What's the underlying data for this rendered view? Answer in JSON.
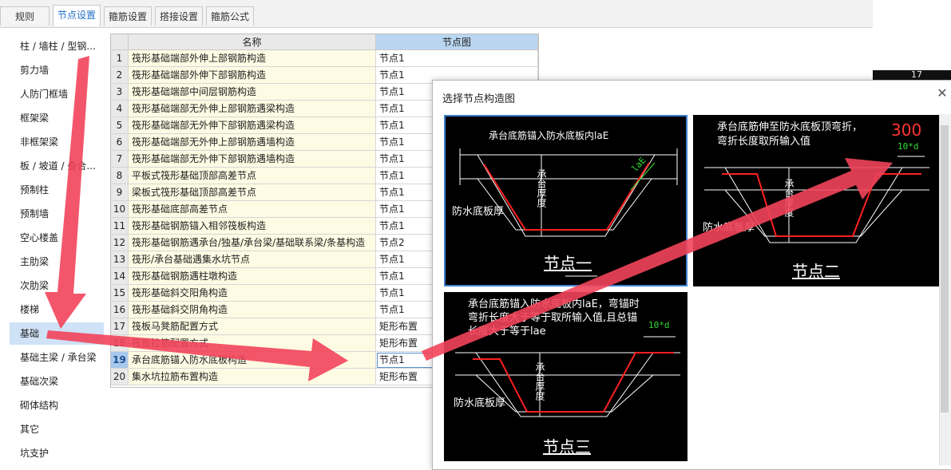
{
  "tabs": [
    "规则",
    "节点设置",
    "箍筋设置",
    "搭接设置",
    "箍筋公式"
  ],
  "sidebar": [
    "柱 / 墙柱 / 型钢...",
    "剪力墙",
    "人防门框墙",
    "框架梁",
    "非框架梁",
    "板 / 坡道 / 叠合...",
    "预制柱",
    "预制墙",
    "空心楼盖",
    "主肋梁",
    "次肋梁",
    "楼梯",
    "基础",
    "基础主梁 / 承台梁",
    "基础次梁",
    "砌体结构",
    "其它",
    "坑支护"
  ],
  "grid": {
    "col_name": "名称",
    "col_node": "节点图",
    "rows": [
      {
        "n": "1",
        "name": "筏形基础端部外伸上部钢筋构造",
        "node": "节点1"
      },
      {
        "n": "2",
        "name": "筏形基础端部外伸下部钢筋构造",
        "node": "节点1"
      },
      {
        "n": "3",
        "name": "筏形基础端部中间层钢筋构造",
        "node": "节点1"
      },
      {
        "n": "4",
        "name": "筏形基础端部无外伸上部钢筋遇梁构造",
        "node": "节点1"
      },
      {
        "n": "5",
        "name": "筏形基础端部无外伸下部钢筋遇梁构造",
        "node": "节点1"
      },
      {
        "n": "6",
        "name": "筏形基础端部无外伸上部钢筋遇墙构造",
        "node": "节点1"
      },
      {
        "n": "7",
        "name": "筏形基础端部无外伸下部钢筋遇墙构造",
        "node": "节点1"
      },
      {
        "n": "8",
        "name": "平板式筏形基础顶部高差节点",
        "node": "节点1"
      },
      {
        "n": "9",
        "name": "梁板式筏形基础顶部高差节点",
        "node": "节点1"
      },
      {
        "n": "10",
        "name": "筏形基础底部高差节点",
        "node": "节点1"
      },
      {
        "n": "11",
        "name": "筏形基础钢筋锚入相邻筏板构造",
        "node": "节点1"
      },
      {
        "n": "12",
        "name": "筏形基础钢筋遇承台/独基/承台梁/基础联系梁/条基构造",
        "node": "节点2"
      },
      {
        "n": "13",
        "name": "筏形/承台基础遇集水坑节点",
        "node": "节点1"
      },
      {
        "n": "14",
        "name": "筏形基础钢筋遇柱墩构造",
        "node": "节点1"
      },
      {
        "n": "15",
        "name": "筏形基础斜交阳角构造",
        "node": "节点1"
      },
      {
        "n": "16",
        "name": "筏形基础斜交阴角构造",
        "node": "节点1"
      },
      {
        "n": "17",
        "name": "筏板马凳筋配置方式",
        "node": "矩形布置"
      },
      {
        "n": "18",
        "name": "筏板拉筋配置方式",
        "node": "矩形布置"
      },
      {
        "n": "19",
        "name": "承台底筋锚入防水底板构造",
        "node": "节点1"
      },
      {
        "n": "20",
        "name": "集水坑拉筋布置构造",
        "node": "矩形布置"
      }
    ]
  },
  "dialog": {
    "title": "选择节点构造图",
    "node1": {
      "caption": "承台底筋锚入防水底板内laE",
      "anchor": "laE",
      "thick": "承台厚度",
      "slab": "防水底板厚",
      "name": "节点一"
    },
    "node2": {
      "caption1": "承台底筋伸至防水底板顶弯折，",
      "caption2": "弯折长度取所输入值",
      "value": "300",
      "dim": "10*d",
      "thick": "承台厚度",
      "slab": "防水底板厚",
      "name": "节点二"
    },
    "node3": {
      "caption1": "承台底筋锚入防水底板内laE，弯锚时",
      "caption2": "弯折长度大于等于取所输入值,且总锚",
      "caption3": "长度大于等于lae",
      "dim": "10*d",
      "thick": "承台厚度",
      "slab": "防水底板厚",
      "name": "节点三"
    }
  },
  "strip": {
    "value": "17"
  },
  "colors": {
    "accent": "#1f6fc5",
    "arrow": "#f2445a",
    "rebar": "#ff2020",
    "dim_green": "#33dd33"
  }
}
